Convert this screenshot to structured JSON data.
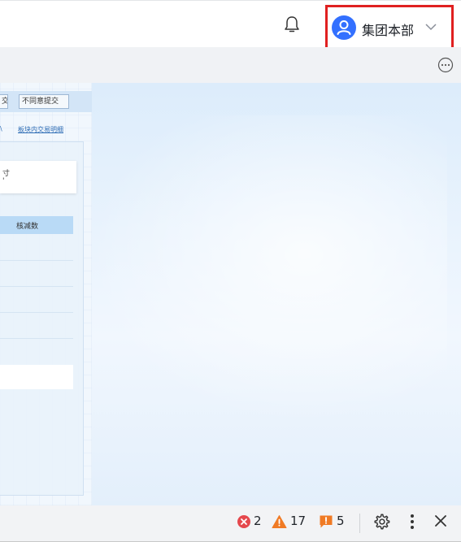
{
  "header": {
    "user_name": "集团本部"
  },
  "panel": {
    "button_partial": "交",
    "button_disagree": "不同意提交",
    "link_partial": "\\",
    "link_detail": "板块内交易明细",
    "card_text_line1": "寸",
    "card_text_line2": "'",
    "table_header": "核减数"
  },
  "statusbar": {
    "errors": "2",
    "warnings": "17",
    "messages": "5"
  },
  "colors": {
    "accent": "#3370ff",
    "error": "#e5484d",
    "warning": "#f07a24",
    "highlight_border": "#e02020"
  }
}
